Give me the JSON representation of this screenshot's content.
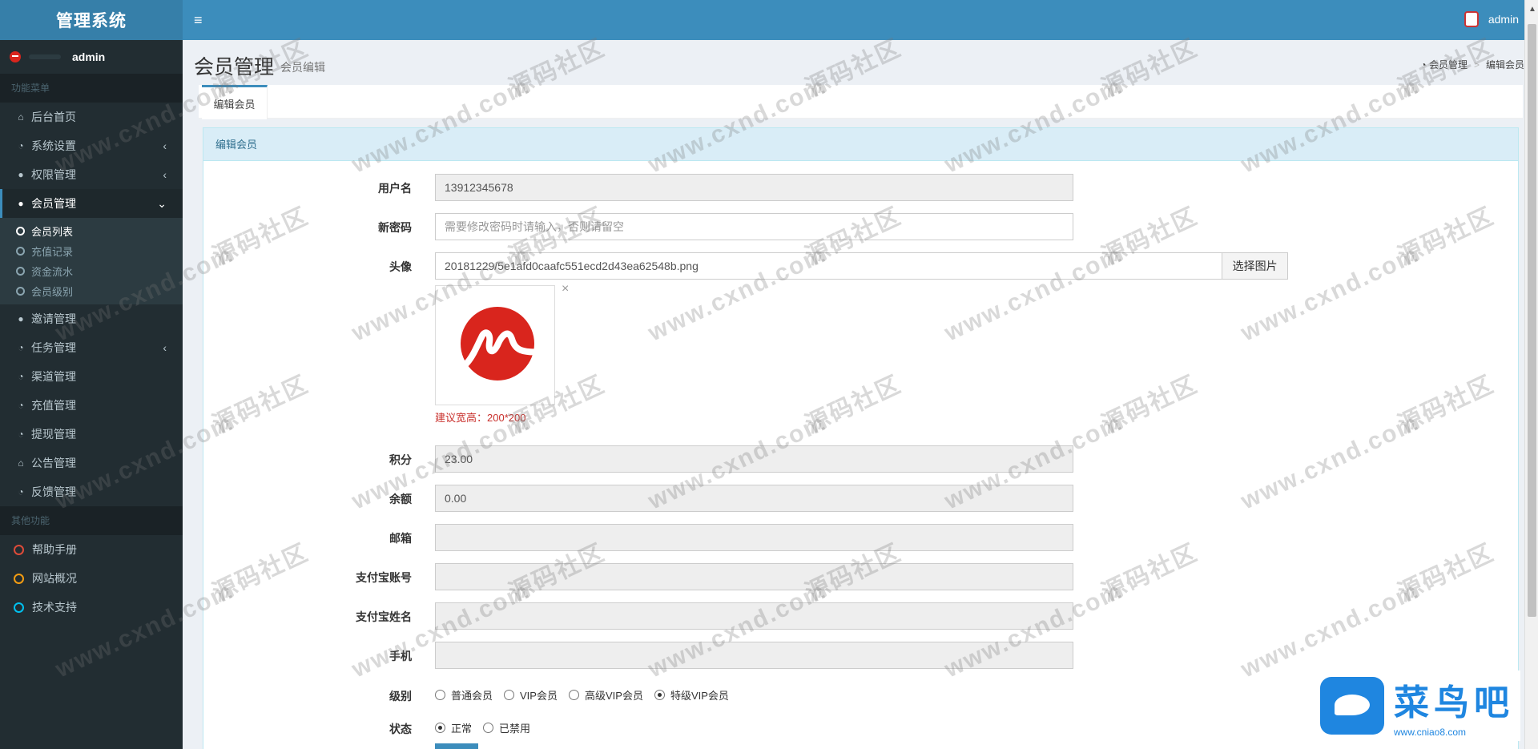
{
  "app": {
    "title": "管理系统",
    "user": "admin",
    "top_user": "admin"
  },
  "sidebar": {
    "header_main": "功能菜单",
    "items": [
      {
        "label": "后台首页"
      },
      {
        "label": "系统设置"
      },
      {
        "label": "权限管理"
      },
      {
        "label": "会员管理"
      },
      {
        "label": "邀请管理"
      },
      {
        "label": "任务管理"
      },
      {
        "label": "渠道管理"
      },
      {
        "label": "充值管理"
      },
      {
        "label": "提现管理"
      },
      {
        "label": "公告管理"
      },
      {
        "label": "反馈管理"
      }
    ],
    "submenu": [
      "会员列表",
      "充值记录",
      "资金流水",
      "会员级别"
    ],
    "header_other": "其他功能",
    "other": [
      {
        "label": "帮助手册",
        "color": "#dd4b39"
      },
      {
        "label": "网站概况",
        "color": "#f39c12"
      },
      {
        "label": "技术支持",
        "color": "#00c0ef"
      }
    ]
  },
  "content": {
    "title": "会员管理",
    "subtitle": "会员编辑",
    "breadcrumb": [
      "会员管理",
      "编辑会员"
    ],
    "tab": "编辑会员",
    "box_title": "编辑会员"
  },
  "form": {
    "username": {
      "label": "用户名",
      "value": "13912345678"
    },
    "password": {
      "label": "新密码",
      "placeholder": "需要修改密码时请输入，否则请留空"
    },
    "avatar": {
      "label": "头像",
      "value": "20181229/5e1afd0caafc551ecd2d43ea62548b.png",
      "button": "选择图片",
      "hint": "建议宽高：200*200",
      "close": "×"
    },
    "points": {
      "label": "积分",
      "value": "23.00"
    },
    "balance": {
      "label": "余额",
      "value": "0.00"
    },
    "email": {
      "label": "邮箱",
      "value": ""
    },
    "alipay_account": {
      "label": "支付宝账号",
      "value": ""
    },
    "alipay_name": {
      "label": "支付宝姓名",
      "value": ""
    },
    "phone": {
      "label": "手机",
      "value": ""
    },
    "level": {
      "label": "级别",
      "options": [
        "普通会员",
        "VIP会员",
        "高级VIP会员",
        "特级VIP会员"
      ],
      "selected": "特级VIP会员"
    },
    "status": {
      "label": "状态",
      "options": [
        "正常",
        "已禁用"
      ],
      "selected": "正常"
    }
  },
  "watermark": {
    "text1": "www.cxnd.com",
    "text2": "源码社区"
  },
  "brand": {
    "name": "菜鸟吧",
    "url": "www.cniao8.com"
  }
}
